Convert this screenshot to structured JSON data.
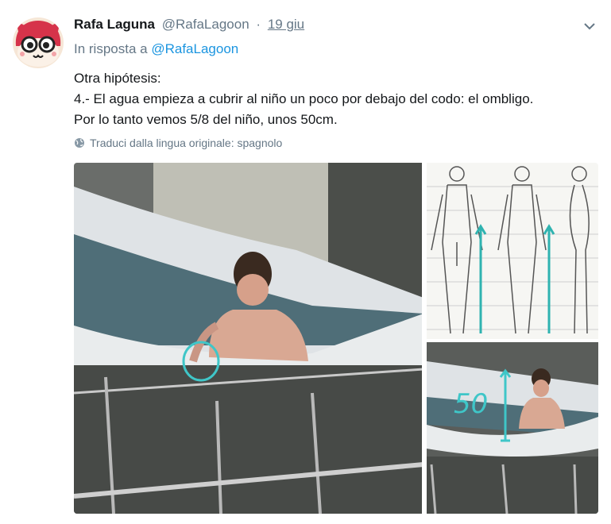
{
  "tweet": {
    "display_name": "Rafa Laguna",
    "handle": "@RafaLagoon",
    "separator": "·",
    "date": "19 giu",
    "reply_prefix": "In risposta a",
    "reply_to": "@RafaLagoon",
    "lines": [
      "Otra hipótesis:",
      "4.- El agua empieza a cubrir al niño un poco por debajo del codo: el ombligo.",
      "Por lo tanto vemos 5/8 del niño, unos 50cm."
    ],
    "translate_label": "Traduci dalla lingua originale: spagnolo",
    "annotation_label": "50"
  },
  "icons": {
    "avatar": "cartoon-cat-avatar",
    "caret": "chevron-down-icon",
    "translate": "globe-icon"
  },
  "colors": {
    "text": "#14171a",
    "secondary": "#657786",
    "link": "#1b95e0",
    "annotation": "#3fc6c8"
  }
}
